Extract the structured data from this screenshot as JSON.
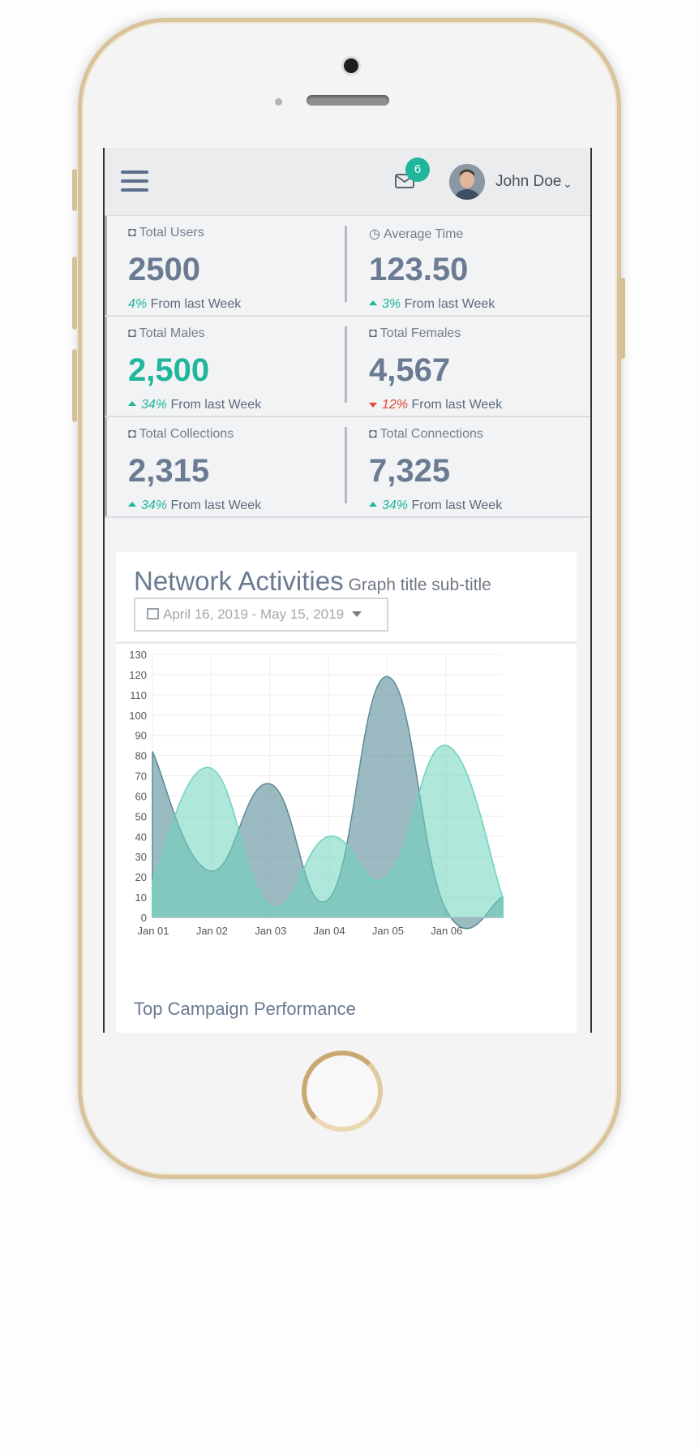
{
  "header": {
    "notification_count": "6",
    "user_name": "John Doe",
    "icons": [
      "hamburger-menu-icon",
      "mail-icon",
      "chevron-down-icon"
    ]
  },
  "stats": [
    {
      "label": "Total Users",
      "icon": "user-icon",
      "value": "2500",
      "pct": "4%",
      "trend": "none",
      "suffix": "From last Week",
      "value_color": "#6a7b93"
    },
    {
      "label": "Average Time",
      "icon": "clock-icon",
      "value": "123.50",
      "pct": "3%",
      "trend": "up",
      "suffix": "From last Week",
      "value_color": "#6a7b93"
    },
    {
      "label": "Total Males",
      "icon": "user-icon",
      "value": "2,500",
      "pct": "34%",
      "trend": "up",
      "suffix": "From last Week",
      "value_color": "#1fb69b"
    },
    {
      "label": "Total Females",
      "icon": "user-icon",
      "value": "4,567",
      "pct": "12%",
      "trend": "down",
      "suffix": "From last Week",
      "value_color": "#6a7b93"
    },
    {
      "label": "Total Collections",
      "icon": "user-icon",
      "value": "2,315",
      "pct": "34%",
      "trend": "up",
      "suffix": "From last Week",
      "value_color": "#6a7b93"
    },
    {
      "label": "Total Connections",
      "icon": "user-icon",
      "value": "7,325",
      "pct": "34%",
      "trend": "up",
      "suffix": "From last Week",
      "value_color": "#6a7b93"
    }
  ],
  "card": {
    "title": "Network Activities",
    "subtitle": "Graph title sub-title",
    "date_range": "April 16, 2019 - May 15, 2019",
    "section_title": "Top Campaign Performance"
  },
  "colors": {
    "accent": "#1fb69b",
    "danger": "#e04a3a",
    "series_dark": "#5a8c97",
    "series_light": "#6dd3bc"
  },
  "chart_data": {
    "type": "area",
    "x": [
      0,
      0.97,
      2.0,
      3.0,
      4.0,
      5.0,
      5.97
    ],
    "categories": [
      "Jan 01",
      "Jan 02",
      "Jan 03",
      "Jan 04",
      "Jan 05",
      "Jan 06"
    ],
    "series": [
      {
        "values": [
          82,
          23,
          66,
          9,
          119,
          4,
          10
        ],
        "color": "#5a8c97"
      },
      {
        "values": [
          18,
          74,
          6,
          40,
          20,
          85,
          10
        ],
        "color": "#6dd3bc"
      }
    ],
    "ylim": [
      0,
      130
    ],
    "yticks": [
      0,
      10,
      20,
      30,
      40,
      50,
      60,
      70,
      80,
      90,
      100,
      110,
      120,
      130
    ],
    "grid": true
  }
}
